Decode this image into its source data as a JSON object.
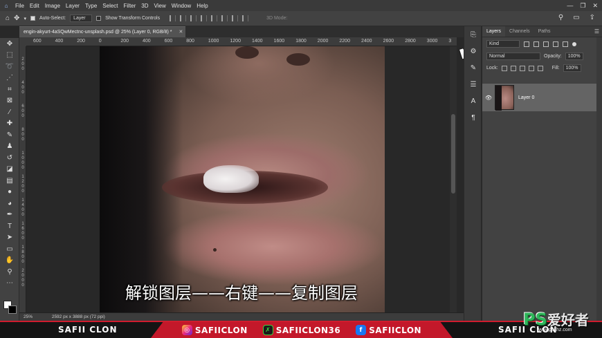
{
  "menubar": {
    "home_icon": "PS",
    "items": [
      "File",
      "Edit",
      "Image",
      "Layer",
      "Type",
      "Select",
      "Filter",
      "3D",
      "View",
      "Window",
      "Help"
    ],
    "window_controls": [
      "—",
      "❐",
      "✕"
    ]
  },
  "options": {
    "auto_select_label": "Auto-Select:",
    "auto_select_checked": true,
    "target_value": "Layer",
    "transform_label": "Show Transform Controls",
    "mode_3d_label": "3D Mode:"
  },
  "document": {
    "tab_title": "engin-akyurt-4aSQwMectnc-unsplash.psd @ 25% (Layer 0, RGB/8) *",
    "close": "✕"
  },
  "ruler": {
    "top": [
      "600",
      "400",
      "200",
      "0",
      "200",
      "400",
      "600",
      "800",
      "1000",
      "1200",
      "1400",
      "1600",
      "1800",
      "2000",
      "2200",
      "2400",
      "2600",
      "2800",
      "3000",
      "3"
    ],
    "left": [
      "2\n0\n0",
      "4\n0\n0",
      "6\n0\n0",
      "8\n0\n0",
      "1\n0\n0\n0",
      "1\n2\n0\n0",
      "1\n4\n0\n0",
      "1\n6\n0\n0",
      "1\n8\n0\n0",
      "2\n0\n0\n0"
    ]
  },
  "canvas": {
    "subtitle": "解锁图层——右键——复制图层"
  },
  "status": {
    "zoom": "25%",
    "dimensions": "2592 px x 3888 px (72 ppi)"
  },
  "layers_panel": {
    "tabs": [
      "Layers",
      "Channels",
      "Paths"
    ],
    "kind_label": "Kind",
    "blend_mode": "Normal",
    "opacity_label": "Opacity:",
    "opacity_value": "100%",
    "lock_label": "Lock:",
    "fill_label": "Fill:",
    "fill_value": "100%",
    "layer_name": "Layer 0"
  },
  "banner": {
    "left_name": "SAFII CLON",
    "instagram": "SAFIICLON",
    "snapchat": "SAFIICLON36",
    "facebook": "SAFIICLON",
    "right_name": "SAFII CLON"
  },
  "watermark": {
    "logo": "PS",
    "chinese": "爱好者",
    "url": "www.psahz.com"
  },
  "colors": {
    "accent_red": "#c3182a",
    "panel_bg": "#424242",
    "watermark_green": "#2fb65a"
  }
}
